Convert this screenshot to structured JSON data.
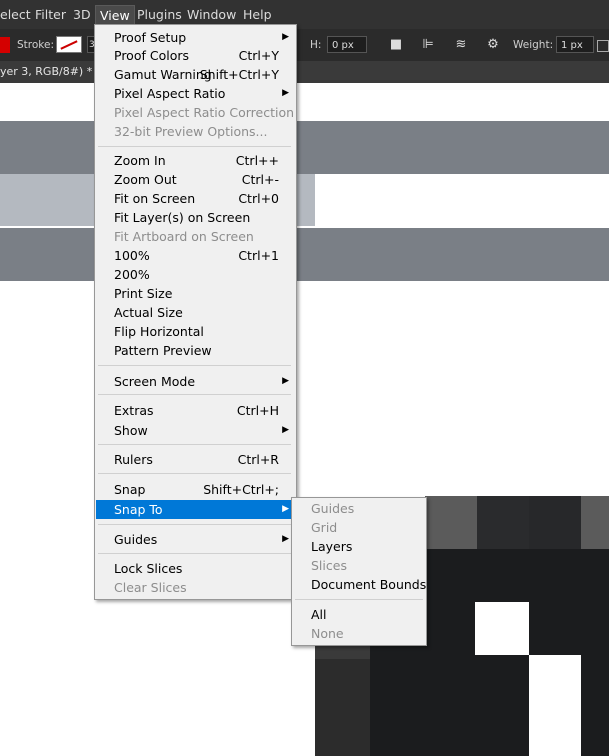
{
  "menubar": {
    "items": [
      "elect",
      "Filter",
      "3D",
      "View",
      "Plugins",
      "Window",
      "Help"
    ]
  },
  "options_bar": {
    "stroke_label": "Stroke:",
    "stroke_value": "3",
    "h_label": "H:",
    "h_value": "0 px",
    "weight_label": "Weight:",
    "weight_value": "1 px"
  },
  "document_tab": {
    "title": "yer 3, RGB/8#) *"
  },
  "view_menu": {
    "items": [
      {
        "label": "Proof Setup",
        "shortcut": "",
        "submenu": true,
        "disabled": false
      },
      {
        "label": "Proof Colors",
        "shortcut": "Ctrl+Y",
        "submenu": false,
        "disabled": false
      },
      {
        "label": "Gamut Warning",
        "shortcut": "Shift+Ctrl+Y",
        "submenu": false,
        "disabled": false
      },
      {
        "label": "Pixel Aspect Ratio",
        "shortcut": "",
        "submenu": true,
        "disabled": false
      },
      {
        "label": "Pixel Aspect Ratio Correction",
        "shortcut": "",
        "submenu": false,
        "disabled": true
      },
      {
        "label": "32-bit Preview Options...",
        "shortcut": "",
        "submenu": false,
        "disabled": true
      },
      {
        "label": "Zoom In",
        "shortcut": "Ctrl++",
        "submenu": false,
        "disabled": false
      },
      {
        "label": "Zoom Out",
        "shortcut": "Ctrl+-",
        "submenu": false,
        "disabled": false
      },
      {
        "label": "Fit on Screen",
        "shortcut": "Ctrl+0",
        "submenu": false,
        "disabled": false
      },
      {
        "label": "Fit Layer(s) on Screen",
        "shortcut": "",
        "submenu": false,
        "disabled": false
      },
      {
        "label": "Fit Artboard on Screen",
        "shortcut": "",
        "submenu": false,
        "disabled": true
      },
      {
        "label": "100%",
        "shortcut": "Ctrl+1",
        "submenu": false,
        "disabled": false
      },
      {
        "label": "200%",
        "shortcut": "",
        "submenu": false,
        "disabled": false
      },
      {
        "label": "Print Size",
        "shortcut": "",
        "submenu": false,
        "disabled": false
      },
      {
        "label": "Actual Size",
        "shortcut": "",
        "submenu": false,
        "disabled": false
      },
      {
        "label": "Flip Horizontal",
        "shortcut": "",
        "submenu": false,
        "disabled": false
      },
      {
        "label": "Pattern Preview",
        "shortcut": "",
        "submenu": false,
        "disabled": false
      },
      {
        "label": "Screen Mode",
        "shortcut": "",
        "submenu": true,
        "disabled": false
      },
      {
        "label": "Extras",
        "shortcut": "Ctrl+H",
        "submenu": false,
        "disabled": false
      },
      {
        "label": "Show",
        "shortcut": "",
        "submenu": true,
        "disabled": false
      },
      {
        "label": "Rulers",
        "shortcut": "Ctrl+R",
        "submenu": false,
        "disabled": false
      },
      {
        "label": "Snap",
        "shortcut": "Shift+Ctrl+;",
        "submenu": false,
        "disabled": false
      },
      {
        "label": "Snap To",
        "shortcut": "",
        "submenu": true,
        "disabled": false,
        "highlighted": true
      },
      {
        "label": "Guides",
        "shortcut": "",
        "submenu": true,
        "disabled": false
      },
      {
        "label": "Lock Slices",
        "shortcut": "",
        "submenu": false,
        "disabled": false
      },
      {
        "label": "Clear Slices",
        "shortcut": "",
        "submenu": false,
        "disabled": true
      }
    ]
  },
  "snap_to_submenu": {
    "items": [
      {
        "label": "Guides",
        "disabled": true
      },
      {
        "label": "Grid",
        "disabled": true
      },
      {
        "label": "Layers",
        "disabled": false
      },
      {
        "label": "Slices",
        "disabled": true
      },
      {
        "label": "Document Bounds",
        "disabled": false
      },
      {
        "label": "All",
        "disabled": false
      },
      {
        "label": "None",
        "disabled": true
      }
    ]
  },
  "colors": {
    "menubar_bg": "#323232",
    "menu_bg": "#f0f0f0",
    "highlight": "#0078d7",
    "disabled_text": "#8d8d8d",
    "swatch_fill": "#d40000"
  }
}
